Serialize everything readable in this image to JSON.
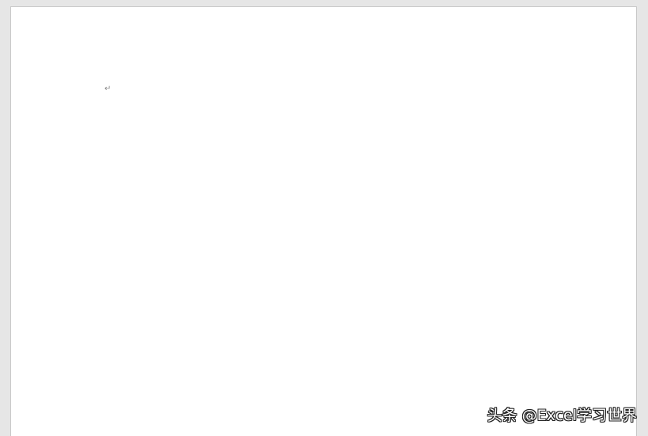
{
  "document": {
    "paragraph_mark": "↵"
  },
  "watermark": {
    "text": "头条 @Excel学习世界"
  },
  "colors": {
    "background": "#e6e6e6",
    "page": "#ffffff",
    "page_border": "#c8c8c8",
    "formatting_mark": "#8a8a8a"
  }
}
